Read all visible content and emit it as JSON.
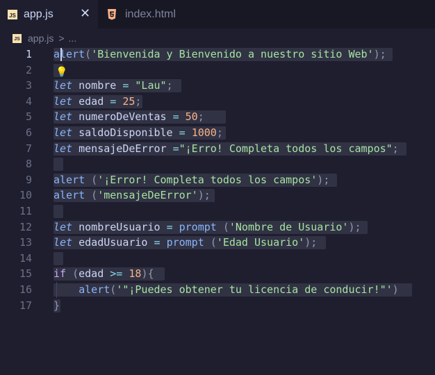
{
  "tabs": [
    {
      "label": "app.js",
      "icon": "js-icon",
      "active": true
    },
    {
      "label": "index.html",
      "icon": "html5-icon",
      "active": false
    }
  ],
  "close_glyph": "✕",
  "js_badge": "JS",
  "breadcrumb": {
    "file": "app.js",
    "sep": ">",
    "rest": "..."
  },
  "lines": [
    {
      "num": "1",
      "tokens": [
        {
          "t": "alert",
          "c": "fn"
        },
        {
          "t": "(",
          "c": "pun"
        },
        {
          "t": "'Bienvenida y Bienvenido a nuestro sitio Web'",
          "c": "str"
        },
        {
          "t": ");",
          "c": "pun"
        }
      ]
    },
    {
      "num": "2",
      "tokens": []
    },
    {
      "num": "3",
      "tokens": [
        {
          "t": "let",
          "c": "kw"
        },
        {
          "t": " nombre ",
          "c": ""
        },
        {
          "t": "=",
          "c": "op"
        },
        {
          "t": " ",
          "c": ""
        },
        {
          "t": "\"Lau\"",
          "c": "str"
        },
        {
          "t": ";",
          "c": "pun"
        }
      ]
    },
    {
      "num": "4",
      "tokens": [
        {
          "t": "let",
          "c": "kw"
        },
        {
          "t": " edad ",
          "c": ""
        },
        {
          "t": "=",
          "c": "op"
        },
        {
          "t": " ",
          "c": ""
        },
        {
          "t": "25",
          "c": "num"
        },
        {
          "t": ";",
          "c": "pun"
        }
      ]
    },
    {
      "num": "5",
      "tokens": [
        {
          "t": "let",
          "c": "kw"
        },
        {
          "t": " numeroDeVentas ",
          "c": ""
        },
        {
          "t": "=",
          "c": "op"
        },
        {
          "t": " ",
          "c": ""
        },
        {
          "t": "50",
          "c": "num"
        },
        {
          "t": ";",
          "c": "pun"
        }
      ]
    },
    {
      "num": "6",
      "tokens": [
        {
          "t": "let",
          "c": "kw"
        },
        {
          "t": " saldoDisponible ",
          "c": ""
        },
        {
          "t": "=",
          "c": "op"
        },
        {
          "t": " ",
          "c": ""
        },
        {
          "t": "1000",
          "c": "num"
        },
        {
          "t": ";",
          "c": "pun"
        }
      ]
    },
    {
      "num": "7",
      "tokens": [
        {
          "t": "let",
          "c": "kw"
        },
        {
          "t": " mensajeDeError ",
          "c": ""
        },
        {
          "t": "=",
          "c": "op"
        },
        {
          "t": "\"¡Erro! Completa todos los campos\"",
          "c": "str"
        },
        {
          "t": ";",
          "c": "pun"
        }
      ]
    },
    {
      "num": "8",
      "tokens": []
    },
    {
      "num": "9",
      "tokens": [
        {
          "t": "alert",
          "c": "fn"
        },
        {
          "t": " (",
          "c": "pun"
        },
        {
          "t": "'¡Error! Completa todos los campos'",
          "c": "str"
        },
        {
          "t": ");",
          "c": "pun"
        }
      ]
    },
    {
      "num": "10",
      "tokens": [
        {
          "t": "alert",
          "c": "fn"
        },
        {
          "t": " (",
          "c": "pun"
        },
        {
          "t": "'mensajeDeError'",
          "c": "str"
        },
        {
          "t": ");",
          "c": "pun"
        }
      ]
    },
    {
      "num": "11",
      "tokens": []
    },
    {
      "num": "12",
      "tokens": [
        {
          "t": "let",
          "c": "kw"
        },
        {
          "t": " nombreUsuario ",
          "c": ""
        },
        {
          "t": "=",
          "c": "op"
        },
        {
          "t": " ",
          "c": ""
        },
        {
          "t": "prompt",
          "c": "fn"
        },
        {
          "t": " (",
          "c": "pun"
        },
        {
          "t": "'Nombre de Usuario'",
          "c": "str"
        },
        {
          "t": ");",
          "c": "pun"
        }
      ]
    },
    {
      "num": "13",
      "tokens": [
        {
          "t": "let",
          "c": "kw"
        },
        {
          "t": " edadUsuario ",
          "c": ""
        },
        {
          "t": "=",
          "c": "op"
        },
        {
          "t": " ",
          "c": ""
        },
        {
          "t": "prompt",
          "c": "fn"
        },
        {
          "t": " (",
          "c": "pun"
        },
        {
          "t": "'Edad Usuario'",
          "c": "str"
        },
        {
          "t": ");",
          "c": "pun"
        }
      ]
    },
    {
      "num": "14",
      "tokens": []
    },
    {
      "num": "15",
      "tokens": [
        {
          "t": "if",
          "c": "ctl"
        },
        {
          "t": " (",
          "c": "pun"
        },
        {
          "t": "edad ",
          "c": ""
        },
        {
          "t": ">=",
          "c": "op"
        },
        {
          "t": " ",
          "c": ""
        },
        {
          "t": "18",
          "c": "num"
        },
        {
          "t": "){",
          "c": "pun"
        }
      ]
    },
    {
      "num": "16",
      "tokens": [
        {
          "t": "    ",
          "c": ""
        },
        {
          "t": "alert",
          "c": "fn"
        },
        {
          "t": "(",
          "c": "pun"
        },
        {
          "t": "'\"¡Puedes obtener tu licencia de conducir!\"'",
          "c": "str"
        },
        {
          "t": ")",
          "c": "pun"
        }
      ]
    },
    {
      "num": "17",
      "tokens": [
        {
          "t": "}",
          "c": "pun"
        }
      ]
    }
  ],
  "selection_widths": [
    488,
    14,
    184,
    128,
    248,
    248,
    508,
    14,
    408,
    232,
    14,
    452,
    392,
    14,
    160,
    516,
    10
  ],
  "colors": {
    "background": "#1e1e2e",
    "string": "#a6e3a1",
    "keyword": "#89b4fa",
    "number": "#fab387",
    "selection": "#313244"
  }
}
